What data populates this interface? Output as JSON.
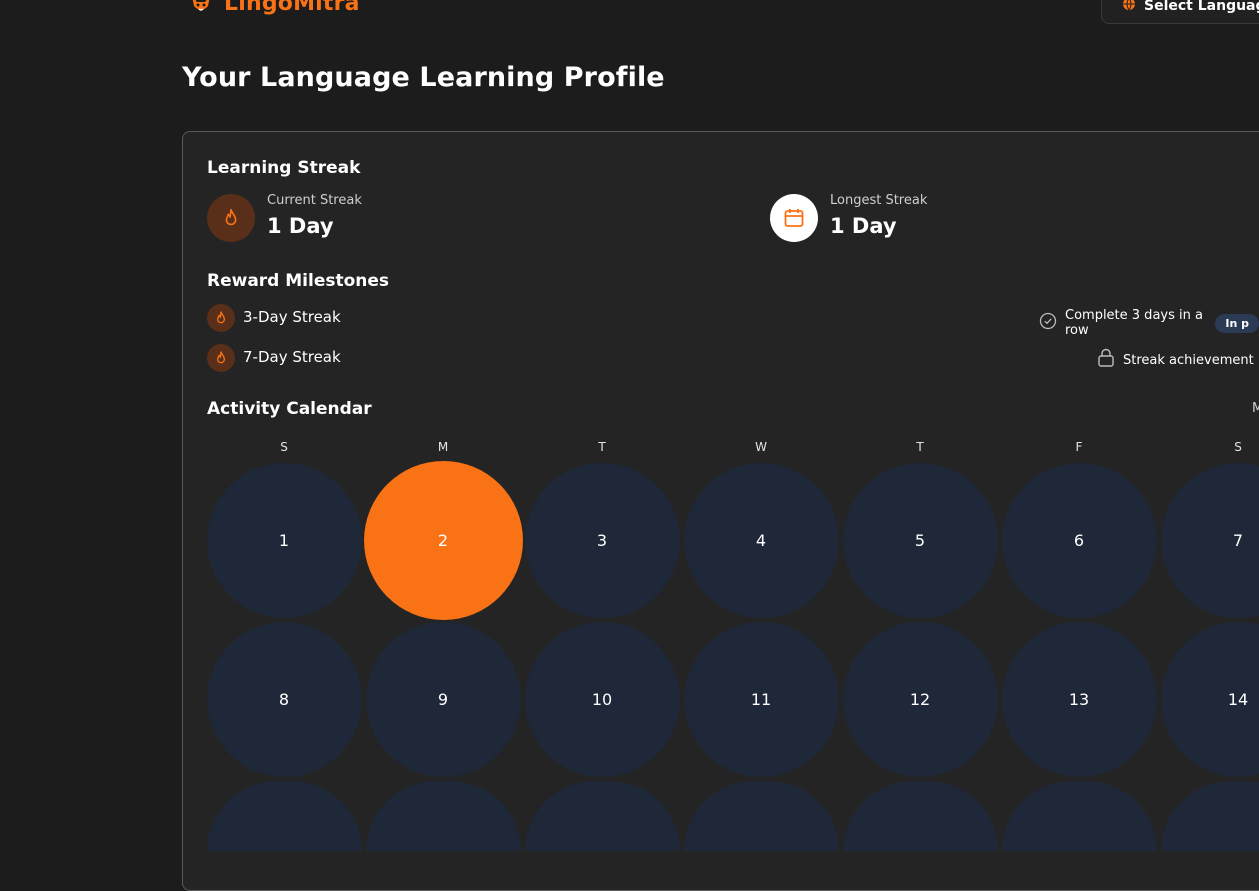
{
  "app": {
    "name": "LingoMitra"
  },
  "header": {
    "language_button": "Select Language"
  },
  "page": {
    "title": "Your Language Learning Profile"
  },
  "streak": {
    "title": "Learning Streak",
    "current_label": "Current Streak",
    "current_value": "1 Day",
    "longest_label": "Longest Streak",
    "longest_value": "1 Day"
  },
  "milestones": {
    "title": "Reward Milestones",
    "items": [
      {
        "name": "3-Day Streak",
        "detail": "Complete 3 days in a row",
        "badge": "In p"
      },
      {
        "name": "7-Day Streak",
        "detail": "Streak achievement"
      }
    ]
  },
  "calendar": {
    "title": "Activity Calendar",
    "month_partial": "M",
    "weekdays": [
      "S",
      "M",
      "T",
      "W",
      "T",
      "F",
      "S"
    ],
    "days": [
      "1",
      "2",
      "3",
      "4",
      "5",
      "6",
      "7",
      "8",
      "9",
      "10",
      "11",
      "12",
      "13",
      "14"
    ],
    "active_day": "2"
  },
  "colors": {
    "accent": "#f97316",
    "background": "#1c1c1c",
    "card": "#242424",
    "day_bg": "#1e2838",
    "badge_bg": "#2b3a55"
  },
  "icons": {
    "logo": "fox-mascot-icon",
    "language": "globe-icon",
    "current_streak": "flame-icon",
    "longest_streak": "calendar-icon",
    "milestone": "flame-icon",
    "in_progress": "check-circle-icon",
    "locked": "lock-icon"
  }
}
